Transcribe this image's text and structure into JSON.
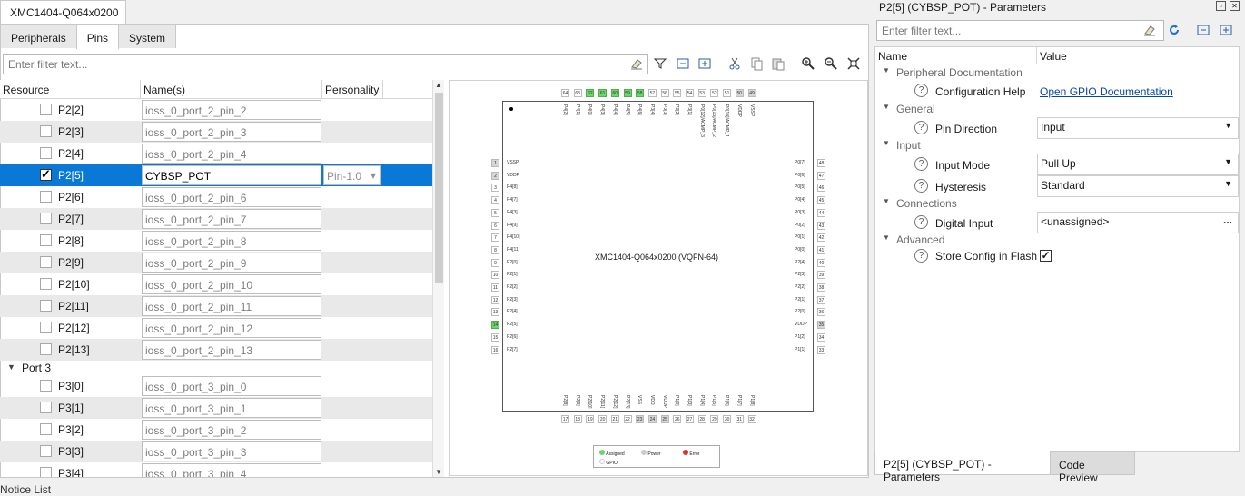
{
  "doc_tab": "XMC1404-Q064x0200",
  "subtabs": [
    "Peripherals",
    "Pins",
    "System"
  ],
  "filter_placeholder": "Enter filter text...",
  "grid": {
    "headers": [
      "Resource",
      "Name(s)",
      "Personality"
    ],
    "rows_top": [
      {
        "res": "P2[2]",
        "name": "ioss_0_port_2_pin_2",
        "checked": false
      },
      {
        "res": "P2[3]",
        "name": "ioss_0_port_2_pin_3",
        "checked": false
      },
      {
        "res": "P2[4]",
        "name": "ioss_0_port_2_pin_4",
        "checked": false
      },
      {
        "res": "P2[5]",
        "name": "CYBSP_POT",
        "checked": true,
        "personality": "Pin-1.0"
      },
      {
        "res": "P2[6]",
        "name": "ioss_0_port_2_pin_6",
        "checked": false
      },
      {
        "res": "P2[7]",
        "name": "ioss_0_port_2_pin_7",
        "checked": false
      },
      {
        "res": "P2[8]",
        "name": "ioss_0_port_2_pin_8",
        "checked": false
      },
      {
        "res": "P2[9]",
        "name": "ioss_0_port_2_pin_9",
        "checked": false
      },
      {
        "res": "P2[10]",
        "name": "ioss_0_port_2_pin_10",
        "checked": false
      },
      {
        "res": "P2[11]",
        "name": "ioss_0_port_2_pin_11",
        "checked": false
      },
      {
        "res": "P2[12]",
        "name": "ioss_0_port_2_pin_12",
        "checked": false
      },
      {
        "res": "P2[13]",
        "name": "ioss_0_port_2_pin_13",
        "checked": false
      }
    ],
    "group": "Port 3",
    "rows_bottom": [
      {
        "res": "P3[0]",
        "name": "ioss_0_port_3_pin_0",
        "checked": false
      },
      {
        "res": "P3[1]",
        "name": "ioss_0_port_3_pin_1",
        "checked": false
      },
      {
        "res": "P3[2]",
        "name": "ioss_0_port_3_pin_2",
        "checked": false
      },
      {
        "res": "P3[3]",
        "name": "ioss_0_port_3_pin_3",
        "checked": false
      },
      {
        "res": "P3[4]",
        "name": "ioss_0_port_3_pin_4",
        "checked": false
      }
    ]
  },
  "chip": {
    "title": "XMC1404-Q064x0200 (VQFN-64)",
    "left_pins": [
      {
        "n": "1",
        "l": "VSSP",
        "s": "p"
      },
      {
        "n": "2",
        "l": "VDDP",
        "s": "p"
      },
      {
        "n": "3",
        "l": "P4[8]",
        "s": ""
      },
      {
        "n": "4",
        "l": "P4[7]",
        "s": ""
      },
      {
        "n": "5",
        "l": "P4[3]",
        "s": ""
      },
      {
        "n": "6",
        "l": "P4[9]",
        "s": ""
      },
      {
        "n": "7",
        "l": "P4[10]",
        "s": ""
      },
      {
        "n": "8",
        "l": "P4[11]",
        "s": ""
      },
      {
        "n": "9",
        "l": "P2[0]",
        "s": ""
      },
      {
        "n": "10",
        "l": "P2[1]",
        "s": ""
      },
      {
        "n": "11",
        "l": "P2[2]",
        "s": ""
      },
      {
        "n": "12",
        "l": "P2[3]",
        "s": ""
      },
      {
        "n": "13",
        "l": "P2[4]",
        "s": ""
      },
      {
        "n": "14",
        "l": "P2[5]",
        "s": "g"
      },
      {
        "n": "15",
        "l": "P2[6]",
        "s": ""
      },
      {
        "n": "16",
        "l": "P2[7]",
        "s": ""
      }
    ],
    "right_pins": [
      {
        "n": "48",
        "l": "P0[7]",
        "s": ""
      },
      {
        "n": "47",
        "l": "P0[6]",
        "s": ""
      },
      {
        "n": "46",
        "l": "P0[5]",
        "s": ""
      },
      {
        "n": "45",
        "l": "P0[4]",
        "s": ""
      },
      {
        "n": "44",
        "l": "P0[3]",
        "s": ""
      },
      {
        "n": "43",
        "l": "P0[2]",
        "s": ""
      },
      {
        "n": "42",
        "l": "P0[1]",
        "s": ""
      },
      {
        "n": "41",
        "l": "P0[0]",
        "s": ""
      },
      {
        "n": "40",
        "l": "P2[4]",
        "s": ""
      },
      {
        "n": "39",
        "l": "P2[3]",
        "s": ""
      },
      {
        "n": "38",
        "l": "P2[2]",
        "s": ""
      },
      {
        "n": "37",
        "l": "P2[1]",
        "s": ""
      },
      {
        "n": "36",
        "l": "P2[0]",
        "s": ""
      },
      {
        "n": "35",
        "l": "VDDP",
        "s": "p"
      },
      {
        "n": "34",
        "l": "P1[2]",
        "s": ""
      },
      {
        "n": "33",
        "l": "P1[1]",
        "s": ""
      }
    ],
    "top_pins": [
      {
        "n": "64",
        "l": "P4[2]",
        "s": ""
      },
      {
        "n": "63",
        "l": "P4[1]",
        "s": ""
      },
      {
        "n": "62",
        "l": "P4[0]",
        "s": "g"
      },
      {
        "n": "61",
        "l": "P4[3]",
        "s": "g"
      },
      {
        "n": "60",
        "l": "P4[4]",
        "s": "g"
      },
      {
        "n": "59",
        "l": "P4[5]",
        "s": "g"
      },
      {
        "n": "58",
        "l": "P4[6]",
        "s": "g"
      },
      {
        "n": "57",
        "l": "P3[4]",
        "s": ""
      },
      {
        "n": "56",
        "l": "P3[3]",
        "s": ""
      },
      {
        "n": "55",
        "l": "P3[2]",
        "s": ""
      },
      {
        "n": "54",
        "l": "P3[1]",
        "s": ""
      },
      {
        "n": "53",
        "l": "P0[12]/ACMP_3",
        "s": ""
      },
      {
        "n": "52",
        "l": "P0[13]/ACMP_2",
        "s": ""
      },
      {
        "n": "51",
        "l": "P0[14]/ACMP_1",
        "s": ""
      },
      {
        "n": "50",
        "l": "VDDP",
        "s": "p"
      },
      {
        "n": "49",
        "l": "VSSP",
        "s": "p"
      }
    ],
    "bottom_pins": [
      {
        "n": "17",
        "l": "P2[8]",
        "s": ""
      },
      {
        "n": "18",
        "l": "P2[9]",
        "s": ""
      },
      {
        "n": "19",
        "l": "P2[10]",
        "s": ""
      },
      {
        "n": "20",
        "l": "P2[11]",
        "s": ""
      },
      {
        "n": "21",
        "l": "P2[12]",
        "s": ""
      },
      {
        "n": "22",
        "l": "P2[13]",
        "s": ""
      },
      {
        "n": "23",
        "l": "VSS",
        "s": "p"
      },
      {
        "n": "24",
        "l": "VDD",
        "s": "p"
      },
      {
        "n": "25",
        "l": "VDDP",
        "s": "p"
      },
      {
        "n": "26",
        "l": "P1[0]",
        "s": ""
      },
      {
        "n": "27",
        "l": "P1[3]",
        "s": ""
      },
      {
        "n": "28",
        "l": "P1[4]",
        "s": ""
      },
      {
        "n": "29",
        "l": "P1[5]",
        "s": ""
      },
      {
        "n": "30",
        "l": "P1[6]",
        "s": ""
      },
      {
        "n": "31",
        "l": "P1[7]",
        "s": ""
      },
      {
        "n": "32",
        "l": "P1[8]",
        "s": ""
      }
    ],
    "legend": {
      "assigned": "Assigned",
      "power": "Power",
      "error": "Error",
      "gpio": "GPIO"
    }
  },
  "params": {
    "title": "P2[5] (CYBSP_POT) - Parameters",
    "filter_placeholder": "Enter filter text...",
    "col_name": "Name",
    "col_value": "Value",
    "cat_peripheral": "Peripheral Documentation",
    "config_help": "Configuration Help",
    "config_help_link": "Open GPIO Documentation",
    "cat_general": "General",
    "pin_direction": "Pin Direction",
    "pin_direction_val": "Input",
    "cat_input": "Input",
    "input_mode": "Input Mode",
    "input_mode_val": "Pull Up",
    "hysteresis": "Hysteresis",
    "hysteresis_val": "Standard",
    "cat_connections": "Connections",
    "digital_input": "Digital Input",
    "digital_input_val": "<unassigned>",
    "cat_advanced": "Advanced",
    "store_config": "Store Config in Flash",
    "store_config_checked": true
  },
  "bottom_tabs": [
    "P2[5] (CYBSP_POT) - Parameters",
    "Code Preview"
  ],
  "status_partial": "Notice List"
}
